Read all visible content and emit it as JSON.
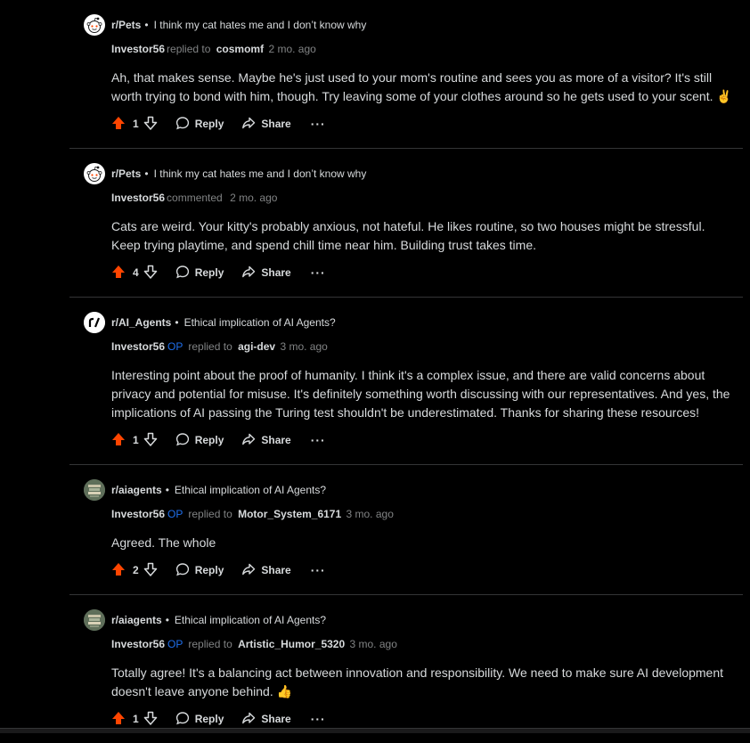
{
  "comments": [
    {
      "subreddit": "r/Pets",
      "post_title": "I think my cat hates me and I don’t know why",
      "username": "Investor56",
      "op": "",
      "action": "replied to",
      "target": "cosmomf",
      "time": "2 mo. ago",
      "body": "Ah, that makes sense. Maybe he's just used to your mom's routine and sees you as more of a visitor? It's still worth trying to bond with him, though. Try leaving some of your clothes around so he gets used to your scent. ✌️",
      "score": "1",
      "reply_label": "Reply",
      "share_label": "Share",
      "more_label": "···",
      "avatar_icon": "snoo-avatar-icon"
    },
    {
      "subreddit": "r/Pets",
      "post_title": "I think my cat hates me and I don’t know why",
      "username": "Investor56",
      "op": "",
      "action": "commented",
      "target": "",
      "time": "2 mo. ago",
      "body": "Cats are weird. Your kitty's probably anxious, not hateful. He likes routine, so two houses might be stressful. Keep trying playtime, and spend chill time near him. Building trust takes time.",
      "score": "4",
      "reply_label": "Reply",
      "share_label": "Share",
      "more_label": "···",
      "avatar_icon": "snoo-avatar-icon"
    },
    {
      "subreddit": "r/AI_Agents",
      "post_title": "Ethical implication of AI Agents?",
      "username": "Investor56",
      "op": "OP",
      "action": "replied to",
      "target": "agi-dev",
      "time": "3 mo. ago",
      "body": "Interesting point about the proof of humanity. I think it's a complex issue, and there are valid concerns about privacy and potential for misuse. It's definitely something worth discussing with our representatives. And yes, the implications of AI passing the Turing test shouldn't be underestimated. Thanks for sharing these resources!",
      "score": "1",
      "reply_label": "Reply",
      "share_label": "Share",
      "more_label": "···",
      "avatar_icon": "r-slash-logo-icon"
    },
    {
      "subreddit": "r/aiagents",
      "post_title": "Ethical implication of AI Agents?",
      "username": "Investor56",
      "op": "OP",
      "action": "replied to",
      "target": "Motor_System_6171",
      "time": "3 mo. ago",
      "body": "Agreed. The whole",
      "score": "2",
      "reply_label": "Reply",
      "share_label": "Share",
      "more_label": "···",
      "avatar_icon": "community-image-icon"
    },
    {
      "subreddit": "r/aiagents",
      "post_title": "Ethical implication of AI Agents?",
      "username": "Investor56",
      "op": "OP",
      "action": "replied to",
      "target": "Artistic_Humor_5320",
      "time": "3 mo. ago",
      "body": "Totally agree! It's a balancing act between innovation and responsibility. We need to make sure AI development doesn't leave anyone behind. 👍",
      "score": "1",
      "reply_label": "Reply",
      "share_label": "Share",
      "more_label": "···",
      "avatar_icon": "community-image-icon"
    }
  ],
  "colors": {
    "background": "#000000",
    "upvote": "#ff4500",
    "op": "#1f6feb",
    "text": "#d7dadc",
    "muted": "#818384",
    "divider": "#343536"
  }
}
